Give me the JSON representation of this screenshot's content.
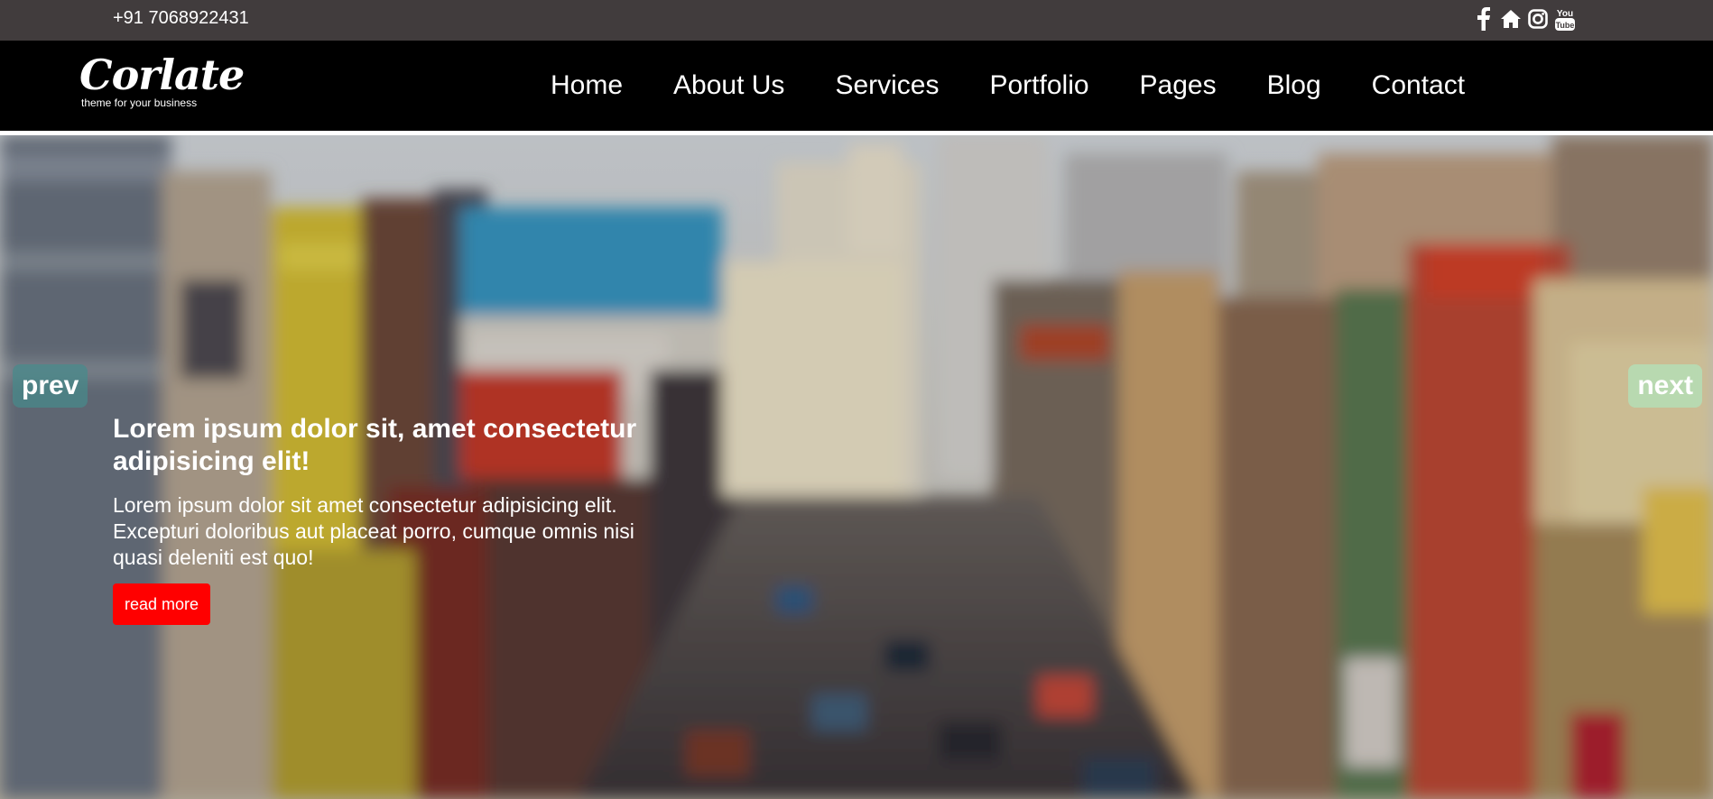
{
  "topbar": {
    "phone": "+91 7068922431",
    "social_icons": [
      "facebook-icon",
      "home-icon",
      "instagram-icon",
      "youtube-icon"
    ],
    "youtube_text_top": "You",
    "youtube_text_bottom": "Tube"
  },
  "header": {
    "logo_word": "Corlate",
    "logo_tagline": "theme for your business",
    "nav": [
      "Home",
      "About Us",
      "Services",
      "Portfolio",
      "Pages",
      "Blog",
      "Contact"
    ]
  },
  "hero": {
    "prev_label": "prev",
    "next_label": "next",
    "title": "Lorem ipsum dolor sit, amet consectetur adipisicing elit!",
    "body": "Lorem ipsum dolor sit amet consectetur adipisicing elit. Excepturi doloribus aut placeat porro, cumque omnis nisi quasi deleniti est quo!",
    "button_label": "read more"
  },
  "colors": {
    "topbar_bg": "#413c3d",
    "header_bg": "#000000",
    "button_red": "#ff0000",
    "text_white": "#ffffff"
  }
}
